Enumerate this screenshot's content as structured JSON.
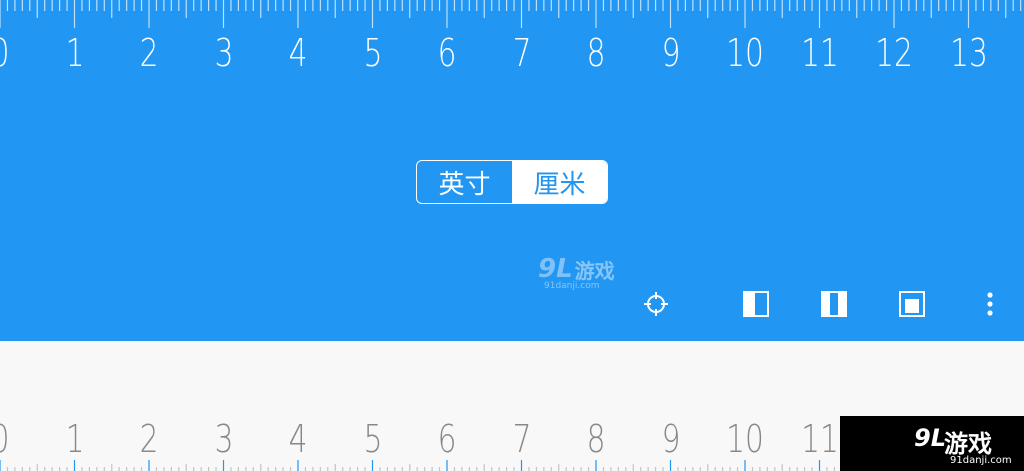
{
  "top_ruler": {
    "labels": [
      "0",
      "1",
      "2",
      "3",
      "4",
      "5",
      "6",
      "7",
      "8",
      "9",
      "10",
      "11",
      "12",
      "13"
    ]
  },
  "unit_toggle": {
    "options": [
      "英寸",
      "厘米"
    ],
    "selected": "厘米"
  },
  "watermark": {
    "logo": "9L",
    "text": "游戏",
    "url": "91danji.com"
  },
  "toolbar": {
    "icons": [
      "crosshair-icon",
      "left-panel-icon",
      "split-panel-icon",
      "center-square-icon",
      "more-vert-icon"
    ]
  },
  "bottom_ruler": {
    "labels": [
      "0",
      "1",
      "2",
      "3",
      "4",
      "5",
      "6",
      "7",
      "8",
      "9",
      "10",
      "11"
    ]
  },
  "corner_watermark": {
    "logo": "9L",
    "text": "游戏",
    "url": "91danji.com"
  },
  "colors": {
    "primary": "#2196f3",
    "surface": "#f8f8f8",
    "text_on_primary": "#ffffff",
    "bottom_numbers": "#888888"
  }
}
